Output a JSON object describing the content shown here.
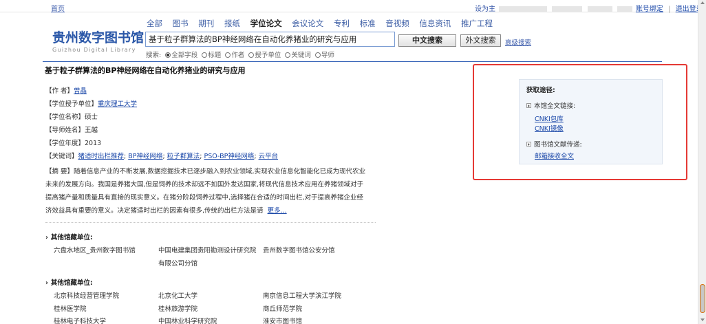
{
  "topbar": {
    "home": "首页",
    "user_prefix": "设为主",
    "account_bind": "账号绑定",
    "logout": "退出登录"
  },
  "logo": {
    "cn": "贵州数字图书馆",
    "en": "Guizhou Digital Library"
  },
  "nav": {
    "categories": [
      "全部",
      "图书",
      "期刊",
      "报纸",
      "学位论文",
      "会议论文",
      "专利",
      "标准",
      "音视频",
      "信息资讯",
      "推广工程"
    ],
    "active": "学位论文"
  },
  "search": {
    "value": "基于粒子群算法的BP神经网络在自动化养猪业的研究与应用",
    "cn_button": "中文搜索",
    "foreign_button": "外文搜索",
    "advanced": "高级搜索",
    "scope_label": "搜索:",
    "scope_options": [
      "全部字段",
      "标题",
      "作者",
      "授予单位",
      "关键词",
      "导师"
    ],
    "scope_selected": "全部字段"
  },
  "doc": {
    "title": "基于粒子群算法的BP神经网络在自动化养猪业的研究与应用",
    "author_label": "【作 者】",
    "author": "曾晶",
    "unit_label": "【学位授予单位】",
    "unit": "重庆理工大学",
    "degree_label": "【学位名称】",
    "degree": "硕士",
    "advisor_label": "【导师姓名】",
    "advisor": "王越",
    "year_label": "【学位年度】",
    "year": "2013",
    "keywords_label": "【关键词】",
    "keywords": [
      "猪适时出栏推荐",
      "BP神经网络",
      "粒子群算法",
      "PSO-BP神经网络",
      "云平台"
    ],
    "abstract_label": "【摘 要】",
    "abstract_lines": [
      "随着信息产业的不断发展,数据挖掘技术已逐步融入到农业领域,实现农业信息化智能化已成为现代农业",
      "未来的发展方向。我国是养猪大国,但是饲养的技术却远不如国外发达国家,将现代信息技术应用在养猪领域对于",
      "提高猪产量和质量具有直接的现实意义。在猪分阶段饲养过程中,选择猪在合适的时间出栏,对于提高养猪企业经",
      "济效益具有重要的意义。决定猪适时出栏的因素有很多,传统的出栏方法是请"
    ],
    "more": "更多..."
  },
  "holdings1": {
    "title": "其他馆藏单位:",
    "libs": [
      "六盘水地区_贵州数字图书馆",
      "中国电建集团贵阳勘测设计研究院",
      "贵州数字图书馆公安分馆"
    ],
    "lib_continued": "有限公司分馆"
  },
  "holdings2": {
    "title": "其他馆藏单位:",
    "libs": [
      "北京科技经营管理学院",
      "北京化工大学",
      "南京信息工程大学滨江学院",
      "桂林医学院",
      "桂林旅游学院",
      "商丘师范学院",
      "桂林电子科技大学",
      "中国林业科学研究院",
      "淮安市图书馆"
    ]
  },
  "panel": {
    "title": "获取途径:",
    "fulltext_label": "本馆全文链接:",
    "links": [
      "CNKI包库",
      "CNKI镜像"
    ],
    "delivery_label": "图书馆文献传递:",
    "delivery_link": "邮箱接收全文"
  },
  "colors": {
    "link": "#1a47a8",
    "brand": "#2a57a8",
    "highlight": "#e53935",
    "panel_bg": "#f2f6fb"
  }
}
